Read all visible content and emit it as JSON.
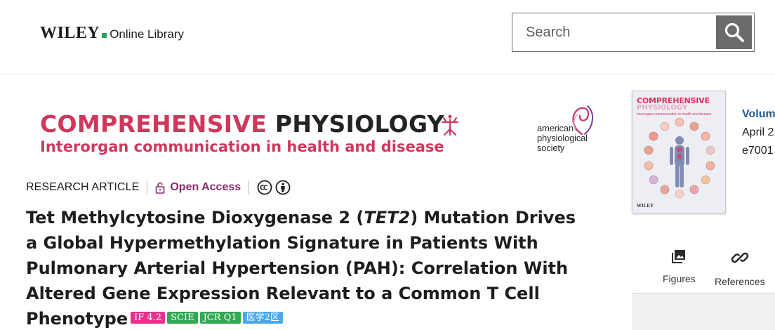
{
  "header": {
    "logo_brand": "WILEY",
    "logo_sub": "Online Library",
    "search_placeholder": "Search"
  },
  "journal_banner": {
    "title_word1": "COMPREHENSIVE",
    "title_word2": "PHYSIOLOGY",
    "subtitle": "Interorgan communication in health and disease",
    "society_line1": "american",
    "society_line2": "physiological",
    "society_line3": "society"
  },
  "article_meta": {
    "type": "RESEARCH ARTICLE",
    "access": "Open Access"
  },
  "article_title": {
    "part1": "Tet Methylcytosine Dioxygenase 2 (",
    "gene": "TET2",
    "part2": ") Mutation Drives a Global Hypermethylation Signature in Patients With Pulmonary Arterial Hypertension (PAH): Correlation With Altered Gene Expression Relevant to a Common T Cell Phenotype"
  },
  "badges": [
    "IF 4.2",
    "SCIE",
    "JCR Q1",
    "医学2区"
  ],
  "cover": {
    "title1": "COMPREHENSIVE",
    "title2": "PHYSIOLOGY",
    "subtitle": "Interorgan communication in health and disease",
    "publisher": "WILEY"
  },
  "issue": {
    "volume": "Volum",
    "date": "April 2",
    "article_id": "e7001"
  },
  "tabs": [
    {
      "label": "Figures",
      "icon": "image-icon"
    },
    {
      "label": "References",
      "icon": "link-icon"
    }
  ],
  "colors": {
    "brand_pink": "#d0375d",
    "open_access_purple": "#8a2a6b",
    "volume_link_blue": "#1f5a9a",
    "wiley_green": "#29a35a",
    "badge_if": "#e8308f",
    "badge_green": "#34a853",
    "badge_blue": "#4aa7e8"
  }
}
